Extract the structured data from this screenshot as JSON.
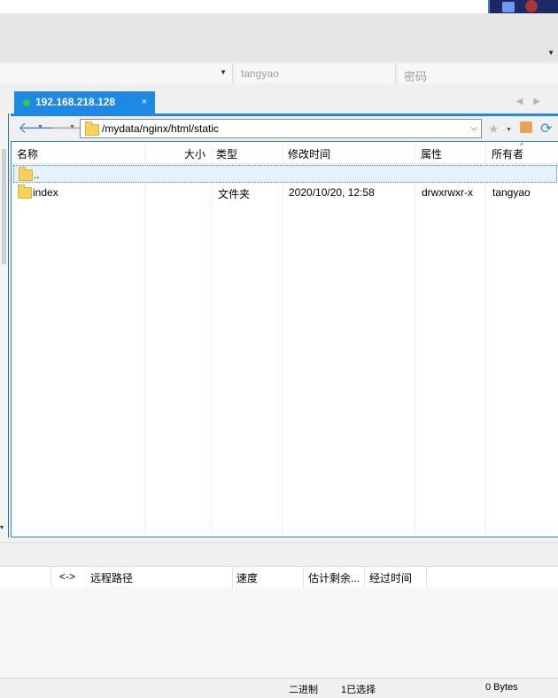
{
  "login": {
    "username": "tangyao",
    "password_placeholder": "密码"
  },
  "session_tab": {
    "label": "192.168.218.128",
    "close": "×"
  },
  "toolbar": {
    "path": "/mydata/nginx/html/static"
  },
  "file_list": {
    "columns": {
      "name": "名称",
      "size": "大小",
      "type": "类型",
      "modified": "修改时间",
      "attributes": "属性",
      "owner": "所有者"
    },
    "rows": [
      {
        "name": "..",
        "size": "",
        "type": "",
        "modified": "",
        "attributes": "",
        "owner": ""
      },
      {
        "name": "index",
        "size": "",
        "type": "文件夹",
        "modified": "2020/10/20, 12:58",
        "attributes": "drwxrwxr-x",
        "owner": "tangyao"
      }
    ]
  },
  "transfer_queue": {
    "columns": {
      "direction": "<->",
      "remote_path": "远程路径",
      "speed": "速度",
      "eta": "估计剩余...",
      "elapsed": "经过时间"
    }
  },
  "status_bar": {
    "mode": "二进制",
    "selection": "1已选择",
    "size": "0 Bytes"
  },
  "colors": {
    "accent": "#1e88e5",
    "connected": "#2ecc40",
    "folder": "#f7d15c"
  }
}
